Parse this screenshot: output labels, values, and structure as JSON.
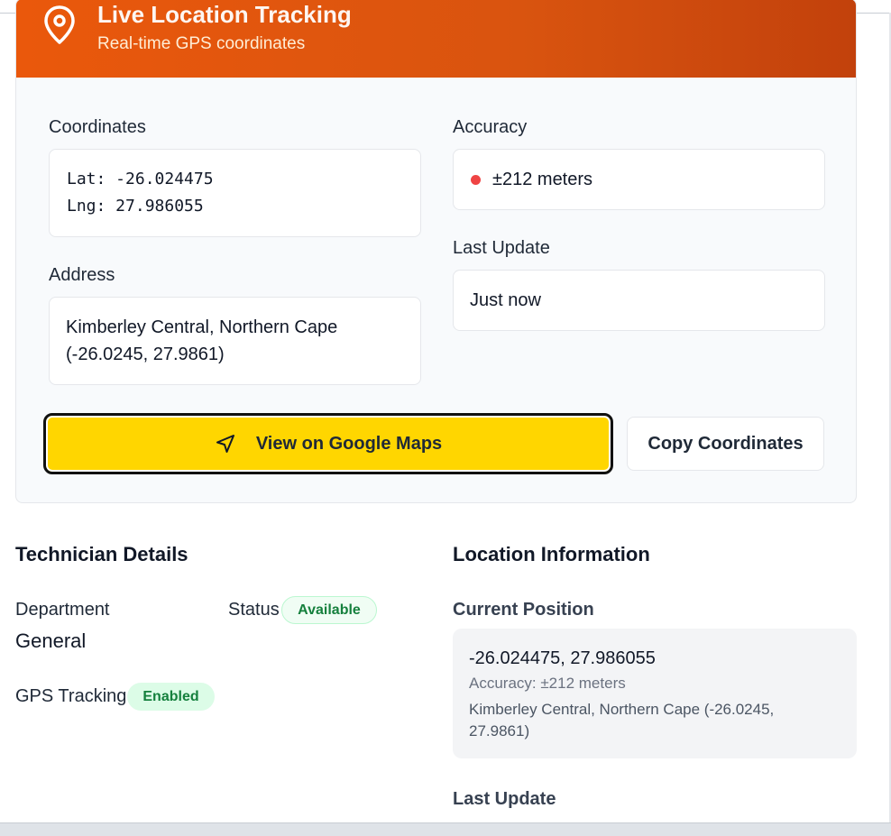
{
  "header": {
    "title": "Live Location Tracking",
    "subtitle": "Real-time GPS coordinates",
    "gradient_start": "#ea580c",
    "gradient_end": "#c2410c"
  },
  "coordinates": {
    "label": "Coordinates",
    "lat": "Lat: -26.024475",
    "lng": "Lng: 27.986055"
  },
  "accuracy": {
    "label": "Accuracy",
    "value": "±212 meters",
    "dot_color": "#ef4444"
  },
  "last_update": {
    "label": "Last Update",
    "value": "Just now"
  },
  "address": {
    "label": "Address",
    "line1": "Kimberley Central, Northern Cape",
    "line2": "(-26.0245, 27.9861)"
  },
  "actions": {
    "maps_label": "View on Google Maps",
    "maps_icon": "navigation-arrow-icon",
    "maps_color": "#ffd600",
    "copy_label": "Copy Coordinates"
  },
  "technician": {
    "title": "Technician Details",
    "department_label": "Department",
    "department_value": "General",
    "status_label": "Status",
    "status_badge": "Available",
    "gps_label": "GPS Tracking",
    "gps_badge": "Enabled"
  },
  "location_info": {
    "title": "Location Information",
    "current_position_label": "Current Position",
    "position_value": "-26.024475, 27.986055",
    "position_accuracy": "Accuracy: ±212 meters",
    "position_address_line1": "Kimberley Central, Northern Cape (-26.0245,",
    "position_address_line2": "27.9861)",
    "last_update_label": "Last Update"
  }
}
